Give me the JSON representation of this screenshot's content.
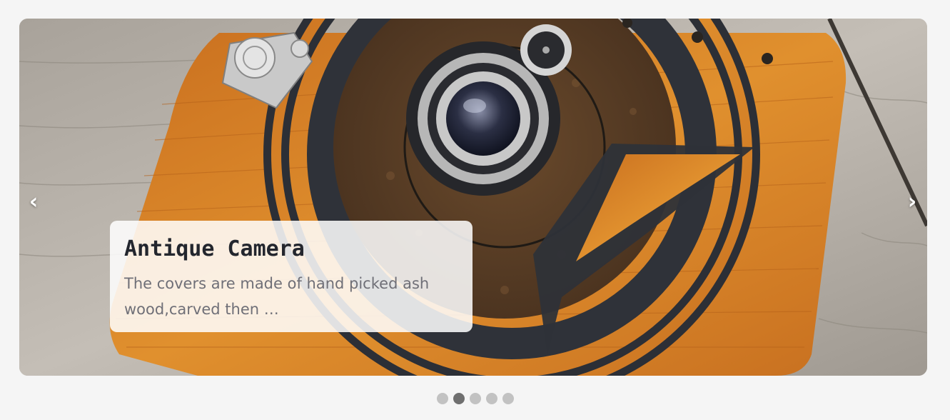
{
  "carousel": {
    "prev_label": "‹",
    "next_label": "›",
    "active_index": 1,
    "slide_count": 5
  },
  "caption": {
    "title": "Antique Camera",
    "text": "The covers are made of hand picked ash wood,carved then …"
  },
  "colors": {
    "page_background": "#f5f5f5",
    "dot_active": "#6f6f6f",
    "dot_inactive": "#c2c2c2",
    "caption_title": "#23262e",
    "caption_text": "#6f6f77"
  }
}
